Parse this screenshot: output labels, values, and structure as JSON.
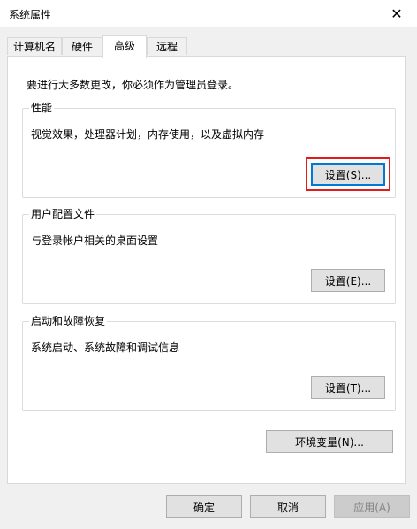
{
  "window": {
    "title": "系统属性",
    "close_glyph": "✕"
  },
  "tabs": [
    {
      "label": "计算机名"
    },
    {
      "label": "硬件"
    },
    {
      "label": "高级",
      "active": true
    },
    {
      "label": "远程"
    }
  ],
  "advanced": {
    "admin_note": "要进行大多数更改，你必须作为管理员登录。",
    "performance": {
      "legend": "性能",
      "description": "视觉效果，处理器计划，内存使用，以及虚拟内存",
      "button": "设置(S)..."
    },
    "user_profiles": {
      "legend": "用户配置文件",
      "description": "与登录帐户相关的桌面设置",
      "button": "设置(E)..."
    },
    "startup_recovery": {
      "legend": "启动和故障恢复",
      "description": "系统启动、系统故障和调试信息",
      "button": "设置(T)..."
    },
    "env_button": "环境变量(N)..."
  },
  "footer": {
    "ok": "确定",
    "cancel": "取消",
    "apply": "应用(A)"
  },
  "colors": {
    "focus_border": "#0078d7",
    "highlight": "#e31b1b"
  }
}
